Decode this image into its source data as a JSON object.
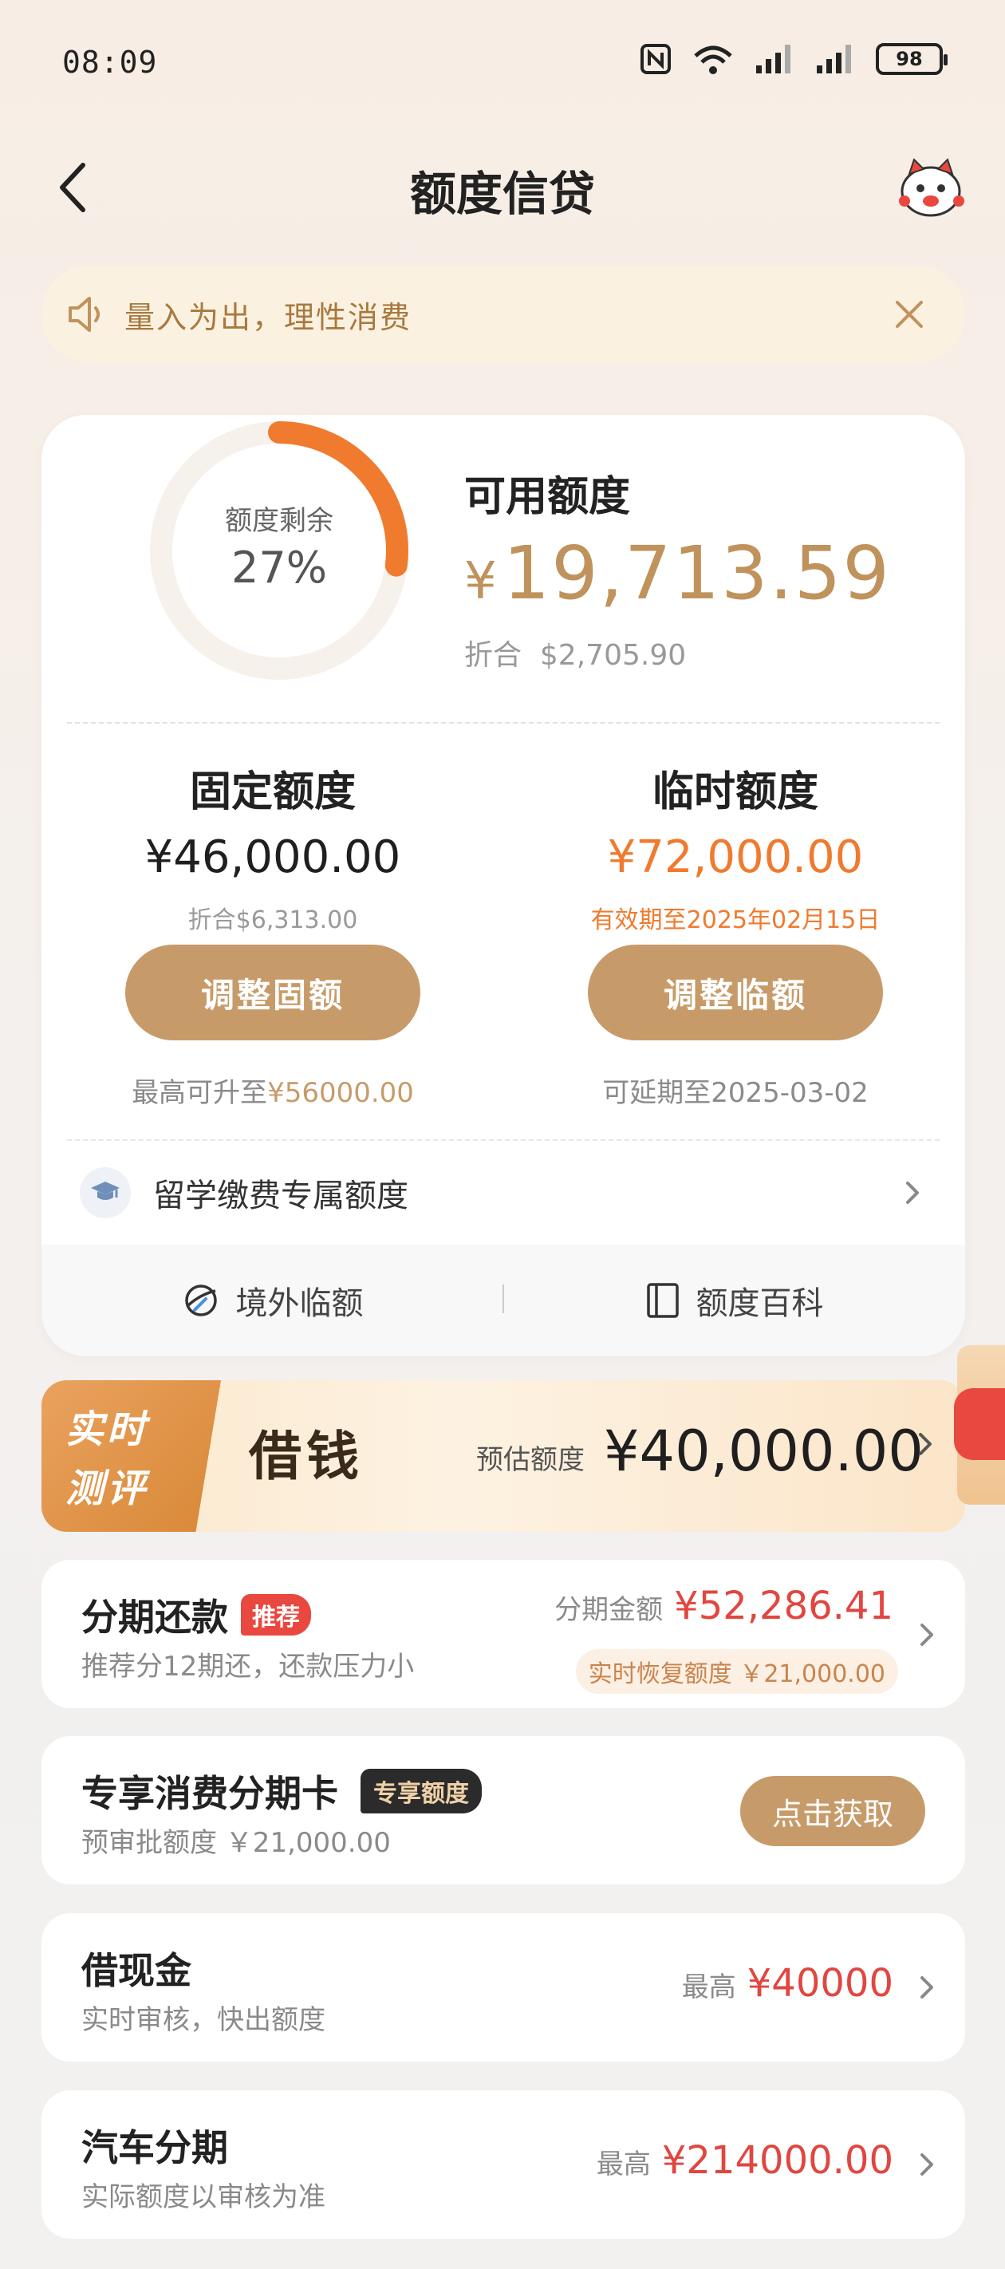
{
  "status_bar": {
    "time": "08:09",
    "battery": "98"
  },
  "header": {
    "title": "额度信贷"
  },
  "notice": {
    "text": "量入为出，理性消费"
  },
  "credit": {
    "ring_label": "额度剩余",
    "ring_percent_text": "27%",
    "ring_fraction": 0.27,
    "available_label": "可用额度",
    "available_currency": "¥",
    "available_amount": "19,713.59",
    "equiv_label": "折合",
    "equiv_amount": "$2,705.90",
    "fixed": {
      "title": "固定额度",
      "amount": "¥46,000.00",
      "equiv": "折合$6,313.00",
      "button": "调整固额",
      "note_prefix": "最高可升至",
      "note_value": "¥56000.00"
    },
    "temp": {
      "title": "临时额度",
      "amount": "¥72,000.00",
      "validity": "有效期至2025年02月15日",
      "button": "调整临额",
      "note": "可延期至2025-03-02"
    },
    "study_label": "留学缴费专属额度",
    "strip": {
      "overseas": "境外临额",
      "wiki": "额度百科"
    }
  },
  "loan_banner": {
    "badge_line1": "实时",
    "badge_line2": "测评",
    "title": "借钱",
    "estimate_label": "预估额度",
    "estimate_amount": "¥40,000.00"
  },
  "cards": {
    "installment": {
      "title": "分期还款",
      "tag": "推荐",
      "sub": "推荐分12期还，还款压力小",
      "amount_label": "分期金额",
      "amount": "¥52,286.41",
      "restore": "实时恢复额度 ￥21,000.00"
    },
    "consume_card": {
      "title": "专享消费分期卡",
      "tag": "专享额度",
      "sub": "预审批额度 ￥21,000.00",
      "button": "点击获取"
    },
    "cash": {
      "title": "借现金",
      "sub": "实时审核，快出额度",
      "max_label": "最高",
      "max_amount": "¥40000"
    },
    "car": {
      "title": "汽车分期",
      "sub": "实际额度以审核为准",
      "max_label": "最高",
      "max_amount": "¥214000.00"
    }
  },
  "colors": {
    "accent": "#c79b69",
    "orange": "#f07a2e",
    "red": "#e14640",
    "gold_text": "#c0925c"
  },
  "icons": [
    "back-arrow-icon",
    "mascot-icon",
    "speaker-icon",
    "close-icon",
    "graduation-cap-icon",
    "chevron-right-icon",
    "globe-icon",
    "book-icon",
    "nfc-icon",
    "wifi-icon",
    "signal-icon",
    "battery-icon"
  ]
}
